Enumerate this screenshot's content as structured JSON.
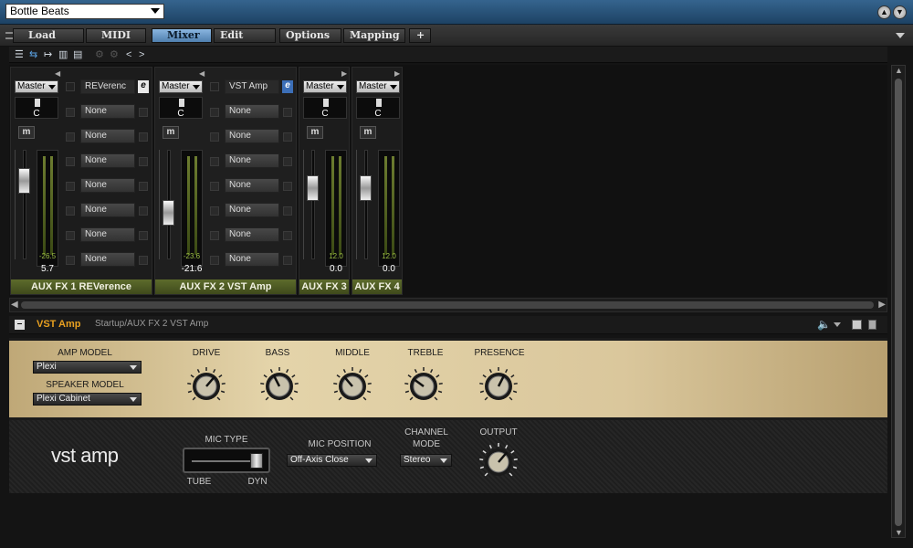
{
  "window": {
    "preset": "Bottle Beats"
  },
  "tabs": [
    {
      "label": "Load"
    },
    {
      "label": "MIDI"
    },
    {
      "label": "Mixer"
    },
    {
      "label": "Edit"
    },
    {
      "label": "Options"
    },
    {
      "label": "Mapping"
    }
  ],
  "tab_add": "+",
  "toolbar": {
    "nav_prev": "<",
    "nav_next": ">"
  },
  "channels": [
    {
      "name": "AUX FX 1 REVerence",
      "output": "Master",
      "pan": "C",
      "mute": "m",
      "peak": "-26.5",
      "volume": "5.7",
      "fader_level_pct": 78,
      "inserts": [
        "REVerenc",
        "None",
        "None",
        "None",
        "None",
        "None",
        "None",
        "None"
      ],
      "edit": "e"
    },
    {
      "name": "AUX FX 2 VST Amp",
      "output": "Master",
      "pan": "C",
      "mute": "m",
      "peak": "-23.6",
      "volume": "-21.6",
      "fader_level_pct": 40,
      "inserts": [
        "VST Amp",
        "None",
        "None",
        "None",
        "None",
        "None",
        "None",
        "None"
      ],
      "edit": "e"
    },
    {
      "name": "AUX FX 3",
      "output": "Master",
      "pan": "C",
      "mute": "m",
      "peak": "12.0",
      "volume": "0.0",
      "fader_level_pct": 70
    },
    {
      "name": "AUX FX 4",
      "output": "Master",
      "pan": "C",
      "mute": "m",
      "peak": "12.0",
      "volume": "0.0",
      "fader_level_pct": 70
    }
  ],
  "plugin": {
    "name": "VST Amp",
    "path": "Startup/AUX FX 2 VST Amp",
    "logo": "vst amp",
    "amp_model_label": "AMP MODEL",
    "amp_model": "Plexi",
    "speaker_model_label": "SPEAKER MODEL",
    "speaker_model": "Plexi Cabinet",
    "knobs": [
      {
        "label": "DRIVE",
        "value_pct": 65
      },
      {
        "label": "BASS",
        "value_pct": 40
      },
      {
        "label": "MIDDLE",
        "value_pct": 35
      },
      {
        "label": "TREBLE",
        "value_pct": 30
      },
      {
        "label": "PRESENCE",
        "value_pct": 60
      }
    ],
    "mic_type_label": "MIC TYPE",
    "mic_tube": "TUBE",
    "mic_dyn": "DYN",
    "mic_position_label": "MIC POSITION",
    "mic_position": "Off-Axis Close",
    "channel_mode_label_1": "CHANNEL",
    "channel_mode_label_2": "MODE",
    "channel_mode": "Stereo",
    "output_label": "OUTPUT",
    "output_pct": 65
  },
  "colors": {
    "accent": "#4f7fae",
    "strip_name_bg": "#4f5b22",
    "plugin_name": "#e8a020"
  }
}
